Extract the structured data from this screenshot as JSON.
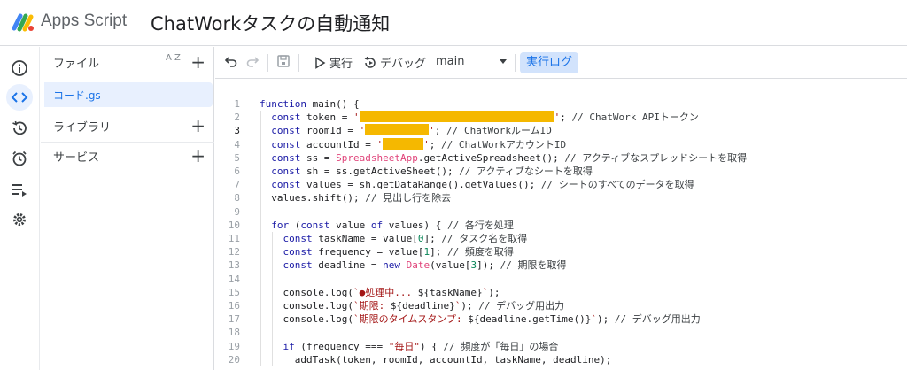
{
  "header": {
    "app_name": "Apps Script",
    "project_title": "ChatWorkタスクの自動通知"
  },
  "files_panel": {
    "files_label": "ファイル",
    "sort_icon_text": "A Z",
    "file_name": "コード.gs",
    "libraries_label": "ライブラリ",
    "services_label": "サービス"
  },
  "toolbar": {
    "run_label": "実行",
    "debug_label": "デバッグ",
    "function_select": "main",
    "run_log_label": "実行ログ"
  },
  "editor": {
    "current_line": 3,
    "lines": [
      {
        "n": "1",
        "segs": [
          [
            "kw",
            "function "
          ],
          [
            "",
            "main() {"
          ]
        ]
      },
      {
        "n": "2",
        "segs": [
          [
            "",
            "  "
          ],
          [
            "kw",
            "const "
          ],
          [
            "",
            "token = "
          ],
          [
            "str",
            "'"
          ],
          [
            "redact",
            "220"
          ],
          [
            "str",
            "'"
          ],
          [
            "",
            "; "
          ],
          [
            "cm",
            "// ChatWork APIトークン"
          ]
        ]
      },
      {
        "n": "3",
        "segs": [
          [
            "",
            "  "
          ],
          [
            "kw",
            "const "
          ],
          [
            "",
            "roomId = "
          ],
          [
            "str",
            "'"
          ],
          [
            "redact",
            "72"
          ],
          [
            "str",
            "'"
          ],
          [
            "",
            "; "
          ],
          [
            "cm",
            "// ChatWorkルームID"
          ]
        ]
      },
      {
        "n": "4",
        "segs": [
          [
            "",
            "  "
          ],
          [
            "kw",
            "const "
          ],
          [
            "",
            "accountId = "
          ],
          [
            "str",
            "'"
          ],
          [
            "redact",
            "46"
          ],
          [
            "str",
            "'"
          ],
          [
            "",
            "; "
          ],
          [
            "cm",
            "// ChatWorkアカウントID"
          ]
        ]
      },
      {
        "n": "5",
        "segs": [
          [
            "",
            "  "
          ],
          [
            "kw",
            "const "
          ],
          [
            "",
            "ss = "
          ],
          [
            "cls",
            "SpreadsheetApp"
          ],
          [
            "",
            ".getActiveSpreadsheet(); "
          ],
          [
            "cm",
            "// アクティブなスプレッドシートを取得"
          ]
        ]
      },
      {
        "n": "6",
        "segs": [
          [
            "",
            "  "
          ],
          [
            "kw",
            "const "
          ],
          [
            "",
            "sh = ss.getActiveSheet(); "
          ],
          [
            "cm",
            "// アクティブなシートを取得"
          ]
        ]
      },
      {
        "n": "7",
        "segs": [
          [
            "",
            "  "
          ],
          [
            "kw",
            "const "
          ],
          [
            "",
            "values = sh.getDataRange().getValues(); "
          ],
          [
            "cm",
            "// シートのすべてのデータを取得"
          ]
        ]
      },
      {
        "n": "8",
        "segs": [
          [
            "",
            "  values.shift(); "
          ],
          [
            "cm",
            "// 見出し行を除去"
          ]
        ]
      },
      {
        "n": "9",
        "segs": []
      },
      {
        "n": "10",
        "segs": [
          [
            "",
            "  "
          ],
          [
            "kw",
            "for "
          ],
          [
            "",
            "("
          ],
          [
            "kw",
            "const "
          ],
          [
            "",
            "value "
          ],
          [
            "kw",
            "of "
          ],
          [
            "",
            "values) { "
          ],
          [
            "cm",
            "// 各行を処理"
          ]
        ]
      },
      {
        "n": "11",
        "segs": [
          [
            "",
            "    "
          ],
          [
            "kw",
            "const "
          ],
          [
            "",
            "taskName = value["
          ],
          [
            "num",
            "0"
          ],
          [
            "",
            "]; "
          ],
          [
            "cm",
            "// タスク名を取得"
          ]
        ]
      },
      {
        "n": "12",
        "segs": [
          [
            "",
            "    "
          ],
          [
            "kw",
            "const "
          ],
          [
            "",
            "frequency = value["
          ],
          [
            "num",
            "1"
          ],
          [
            "",
            "]; "
          ],
          [
            "cm",
            "// 頻度を取得"
          ]
        ]
      },
      {
        "n": "13",
        "segs": [
          [
            "",
            "    "
          ],
          [
            "kw",
            "const "
          ],
          [
            "",
            "deadline = "
          ],
          [
            "kw",
            "new "
          ],
          [
            "cls",
            "Date"
          ],
          [
            "",
            "(value["
          ],
          [
            "num",
            "3"
          ],
          [
            "",
            "]); "
          ],
          [
            "cm",
            "// 期限を取得"
          ]
        ]
      },
      {
        "n": "14",
        "segs": []
      },
      {
        "n": "15",
        "segs": [
          [
            "",
            "    console.log("
          ],
          [
            "str",
            "`●処理中... "
          ],
          [
            "",
            "${taskName}"
          ],
          [
            "str",
            "`"
          ],
          [
            "",
            ");"
          ]
        ]
      },
      {
        "n": "16",
        "segs": [
          [
            "",
            "    console.log("
          ],
          [
            "str",
            "`期限: "
          ],
          [
            "",
            "${deadline}"
          ],
          [
            "str",
            "`"
          ],
          [
            "",
            "); "
          ],
          [
            "cm",
            "// デバッグ用出力"
          ]
        ]
      },
      {
        "n": "17",
        "segs": [
          [
            "",
            "    console.log("
          ],
          [
            "str",
            "`期限のタイムスタンプ: "
          ],
          [
            "",
            "${deadline.getTime()}"
          ],
          [
            "str",
            "`"
          ],
          [
            "",
            "); "
          ],
          [
            "cm",
            "// デバッグ用出力"
          ]
        ]
      },
      {
        "n": "18",
        "segs": []
      },
      {
        "n": "19",
        "segs": [
          [
            "",
            "    "
          ],
          [
            "kw",
            "if "
          ],
          [
            "",
            "(frequency === "
          ],
          [
            "str",
            "\"毎日\""
          ],
          [
            "",
            ") { "
          ],
          [
            "cm",
            "// 頻度が「毎日」の場合"
          ]
        ]
      },
      {
        "n": "20",
        "segs": [
          [
            "",
            "      addTask(token, roomId, accountId, taskName, deadline);"
          ]
        ]
      }
    ]
  }
}
